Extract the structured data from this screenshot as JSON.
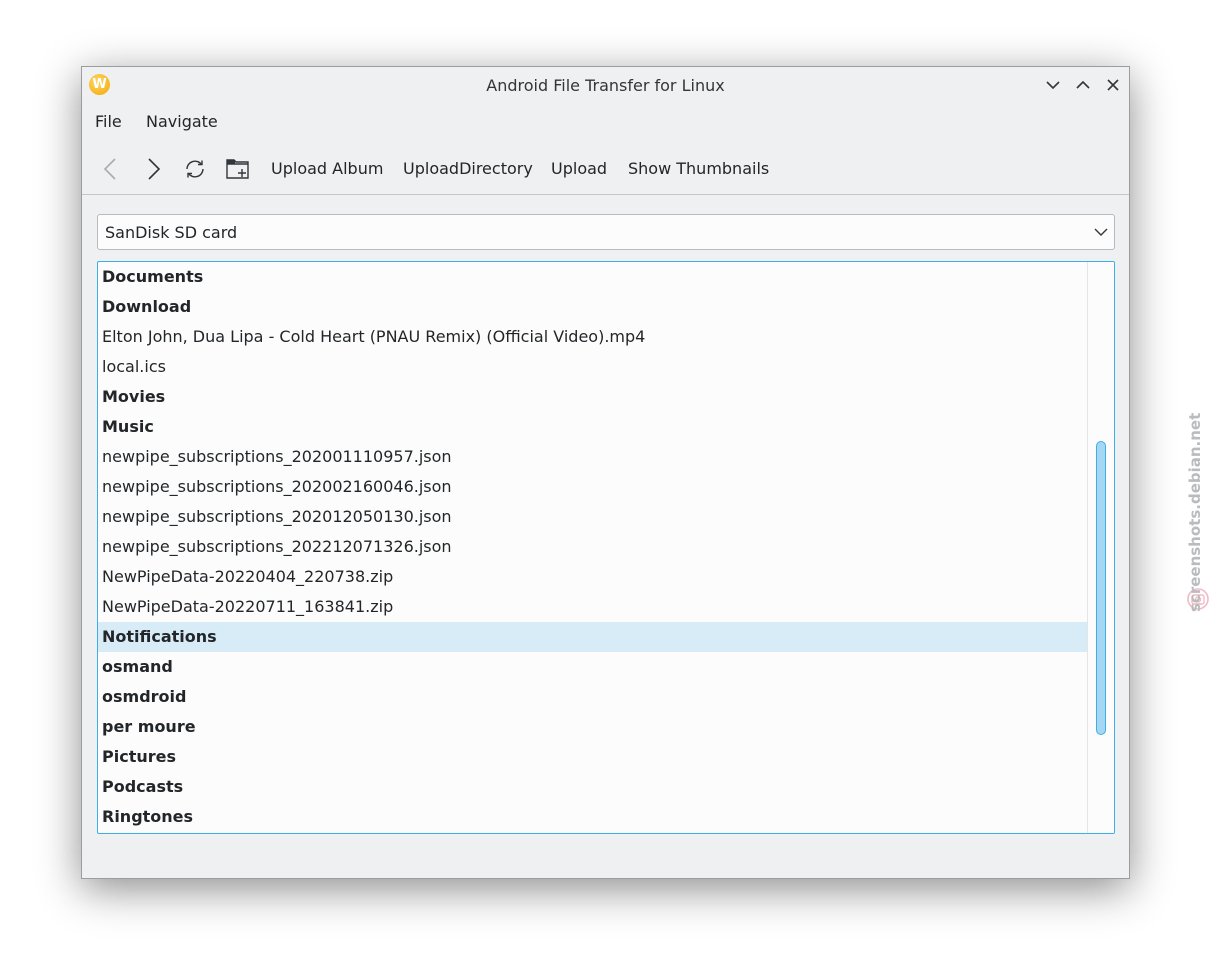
{
  "window": {
    "title": "Android File Transfer for Linux",
    "app_icon_letter": "W"
  },
  "menu": {
    "file": "File",
    "navigate": "Navigate"
  },
  "toolbar": {
    "back_icon": "chevron-left-icon",
    "forward_icon": "chevron-right-icon",
    "refresh_icon": "refresh-icon",
    "new_folder_icon": "new-folder-icon",
    "upload_album": "Upload Album",
    "upload_directory": "UploadDirectory",
    "upload": "Upload",
    "show_thumbnails": "Show Thumbnails"
  },
  "storage": {
    "selected": "SanDisk SD card"
  },
  "files": [
    {
      "name": "Documents",
      "dir": true
    },
    {
      "name": "Download",
      "dir": true
    },
    {
      "name": "Elton John, Dua Lipa - Cold Heart (PNAU Remix) (Official Video).mp4",
      "dir": false
    },
    {
      "name": "local.ics",
      "dir": false
    },
    {
      "name": "Movies",
      "dir": true
    },
    {
      "name": "Music",
      "dir": true
    },
    {
      "name": "newpipe_subscriptions_202001110957.json",
      "dir": false
    },
    {
      "name": "newpipe_subscriptions_202002160046.json",
      "dir": false
    },
    {
      "name": "newpipe_subscriptions_202012050130.json",
      "dir": false
    },
    {
      "name": "newpipe_subscriptions_202212071326.json",
      "dir": false
    },
    {
      "name": "NewPipeData-20220404_220738.zip",
      "dir": false
    },
    {
      "name": "NewPipeData-20220711_163841.zip",
      "dir": false
    },
    {
      "name": "Notifications",
      "dir": true,
      "selected": true
    },
    {
      "name": "osmand",
      "dir": true
    },
    {
      "name": "osmdroid",
      "dir": true
    },
    {
      "name": "per moure",
      "dir": true
    },
    {
      "name": "Pictures",
      "dir": true
    },
    {
      "name": "Podcasts",
      "dir": true
    },
    {
      "name": "Ringtones",
      "dir": true
    }
  ],
  "watermark": {
    "text": "screenshots.debian.net"
  },
  "colors": {
    "accent": "#3daee9",
    "selection": "#d8ecf8",
    "window_bg": "#eff0f1"
  }
}
